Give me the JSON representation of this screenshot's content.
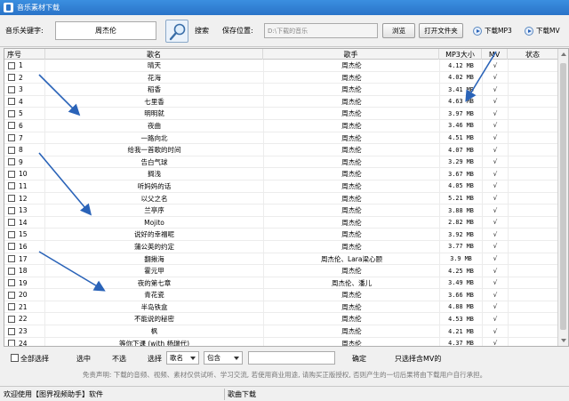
{
  "window": {
    "title": "音乐素材下载"
  },
  "toolbar": {
    "keyword_label": "音乐关键字:",
    "keyword_value": "周杰伦",
    "search_label": "搜索",
    "save_location_label": "保存位置:",
    "save_path": "D:\\下载的音乐",
    "browse_label": "浏览",
    "open_folder_label": "打开文件夹",
    "download_mp3_label": "下载MP3",
    "download_mv_label": "下载MV"
  },
  "table": {
    "headers": {
      "index": "序号",
      "song": "歌名",
      "singer": "歌手",
      "size": "MP3大小",
      "mv": "MV",
      "status": "状态"
    },
    "rows": [
      {
        "num": "1",
        "song": "晴天",
        "singer": "周杰伦",
        "size": "4.12 MB",
        "mv": "√"
      },
      {
        "num": "2",
        "song": "花海",
        "singer": "周杰伦",
        "size": "4.02 MB",
        "mv": "√"
      },
      {
        "num": "3",
        "song": "稻香",
        "singer": "周杰伦",
        "size": "3.41 MB",
        "mv": "√"
      },
      {
        "num": "4",
        "song": "七里香",
        "singer": "周杰伦",
        "size": "4.63 MB",
        "mv": "√"
      },
      {
        "num": "5",
        "song": "明明就",
        "singer": "周杰伦",
        "size": "3.97 MB",
        "mv": "√"
      },
      {
        "num": "6",
        "song": "夜曲",
        "singer": "周杰伦",
        "size": "3.46 MB",
        "mv": "√"
      },
      {
        "num": "7",
        "song": "一路向北",
        "singer": "周杰伦",
        "size": "4.51 MB",
        "mv": "√"
      },
      {
        "num": "8",
        "song": "给我一首歌的时间",
        "singer": "周杰伦",
        "size": "4.07 MB",
        "mv": "√"
      },
      {
        "num": "9",
        "song": "告白气球",
        "singer": "周杰伦",
        "size": "3.29 MB",
        "mv": "√"
      },
      {
        "num": "10",
        "song": "搁浅",
        "singer": "周杰伦",
        "size": "3.67 MB",
        "mv": "√"
      },
      {
        "num": "11",
        "song": "听妈妈的话",
        "singer": "周杰伦",
        "size": "4.05 MB",
        "mv": "√"
      },
      {
        "num": "12",
        "song": "以父之名",
        "singer": "周杰伦",
        "size": "5.21 MB",
        "mv": "√"
      },
      {
        "num": "13",
        "song": "兰亭序",
        "singer": "周杰伦",
        "size": "3.88 MB",
        "mv": "√"
      },
      {
        "num": "14",
        "song": "Mojito",
        "singer": "周杰伦",
        "size": "2.82 MB",
        "mv": "√"
      },
      {
        "num": "15",
        "song": "说好的幸福呢",
        "singer": "周杰伦",
        "size": "3.92 MB",
        "mv": "√"
      },
      {
        "num": "16",
        "song": "蒲公英的约定",
        "singer": "周杰伦",
        "size": "3.77 MB",
        "mv": "√"
      },
      {
        "num": "17",
        "song": "翻揪海",
        "singer": "周杰伦、Lara梁心颐",
        "size": "3.9 MB",
        "mv": "√"
      },
      {
        "num": "18",
        "song": "霍元甲",
        "singer": "周杰伦",
        "size": "4.25 MB",
        "mv": "√"
      },
      {
        "num": "19",
        "song": "夜的第七章",
        "singer": "周杰伦、潘儿",
        "size": "3.49 MB",
        "mv": "√"
      },
      {
        "num": "20",
        "song": "青花瓷",
        "singer": "周杰伦",
        "size": "3.66 MB",
        "mv": "√"
      },
      {
        "num": "21",
        "song": "半岛铁盒",
        "singer": "周杰伦",
        "size": "4.88 MB",
        "mv": "√"
      },
      {
        "num": "22",
        "song": "不能说的秘密",
        "singer": "周杰伦",
        "size": "4.53 MB",
        "mv": "√"
      },
      {
        "num": "23",
        "song": "枫",
        "singer": "周杰伦",
        "size": "4.21 MB",
        "mv": "√"
      },
      {
        "num": "24",
        "song": "等你下课 (with 杨瑞代)",
        "singer": "周杰伦",
        "size": "4.37 MB",
        "mv": "√"
      }
    ]
  },
  "bottom": {
    "select_all": "全部选择",
    "select": "选中",
    "deselect": "不选",
    "choose": "选择",
    "field_value": "歌名",
    "match_value": "包含",
    "confirm": "确定",
    "only_mv": "只选择含MV的"
  },
  "disclaimer": "免责声明: 下载的音频、视频、素材仅供试听、学习交流, 若使用商业用途, 请购买正版授权, 否则产生的一切后果将由下载用户自行承担。",
  "statusbar": {
    "left": "欢迎使用【图界视频助手】软件",
    "right": "歌曲下载"
  },
  "colors": {
    "titlebar": "#2a73c8",
    "annotation_arrow": "#2a63b8"
  }
}
